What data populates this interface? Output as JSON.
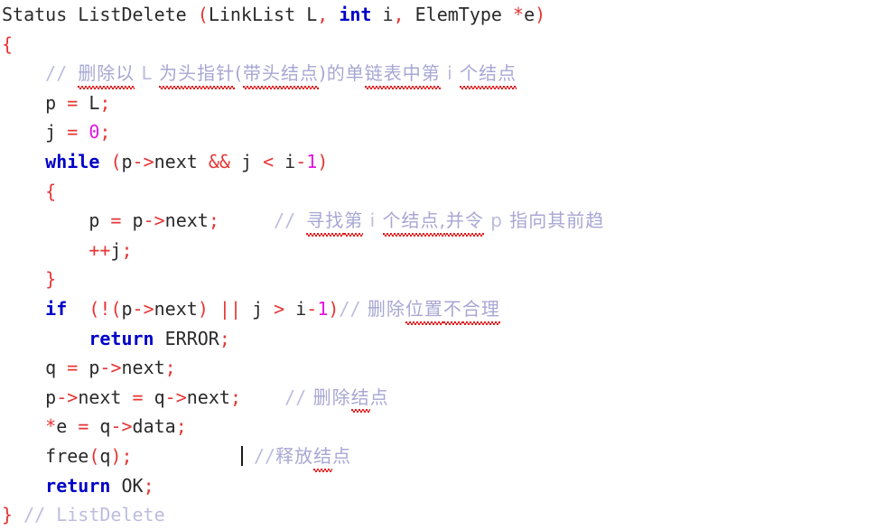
{
  "editor": {
    "language": "C",
    "background_color": "#ffffff",
    "font_size_px": 20,
    "caret_visible": true,
    "colors": {
      "plain_text": "#2a2a2a",
      "keyword": "#0000c8",
      "punctuation_operator": "#e63434",
      "number_literal": "#e215e2",
      "comment": "#bcbcdf",
      "spellcheck_underline": "#e01b1b"
    }
  },
  "code": {
    "function_name": "ListDelete",
    "lines": [
      {
        "n": 1,
        "indent": "",
        "text": "Status ListDelete (LinkList L, int i, ElemType *e)",
        "tokens": {
          "ret_type": "Status",
          "name": "ListDelete",
          "open_paren": "(",
          "param1_type": "LinkList",
          "param1_name": "L",
          "comma1": ",",
          "param2_type": "int",
          "param2_name": "i",
          "comma2": ",",
          "param3_type": "ElemType",
          "param3_star": "*",
          "param3_name": "e",
          "close_paren": ")"
        }
      },
      {
        "n": 2,
        "text": "{",
        "brace": "{"
      },
      {
        "n": 3,
        "comment_slashes": "//",
        "comment_parts": [
          {
            "t": "删除以",
            "spell": true
          },
          {
            "t": " L "
          },
          {
            "t": "为头指针",
            "spell": true
          },
          {
            "t": "("
          },
          {
            "t": "带头结点",
            "spell": true
          },
          {
            "t": ")的单"
          },
          {
            "t": "链表中第",
            "spell": true
          },
          {
            "t": " i "
          },
          {
            "t": "个结点",
            "spell": true
          }
        ],
        "comment_plain": "// 删除以 L 为头指针(带头结点)的单链表中第 i 个结点"
      },
      {
        "n": 4,
        "lhs": "p",
        "eq": "=",
        "rhs": "L",
        "semi": ";",
        "text": "p = L;"
      },
      {
        "n": 5,
        "lhs": "j",
        "eq": "=",
        "rhs": "0",
        "semi": ";",
        "text": "j = 0;"
      },
      {
        "n": 6,
        "keyword": "while",
        "text": "while (p->next && j < i-1)",
        "cond": "(p->next && j < i-1)"
      },
      {
        "n": 7,
        "brace": "{",
        "text": "{"
      },
      {
        "n": 8,
        "text": "p = p->next;",
        "comment_slashes": "//",
        "comment_parts": [
          {
            "t": "寻找",
            "spell": true
          },
          {
            "t": "第",
            "spell": true
          },
          {
            "t": " i "
          },
          {
            "t": "个结点",
            "spell": true
          },
          {
            "t": ",",
            "spell": true
          },
          {
            "t": "并令",
            "spell": true
          },
          {
            "t": " p "
          },
          {
            "t": "指向其前趋"
          }
        ],
        "comment_plain": "// 寻找第 i 个结点,并令 p 指向其前趋"
      },
      {
        "n": 9,
        "text": "++j;"
      },
      {
        "n": 10,
        "brace": "}",
        "text": "}"
      },
      {
        "n": 11,
        "keyword": "if",
        "text": "if  (!(p->next) || j > i-1)",
        "comment_slashes": "//",
        "comment_parts": [
          {
            "t": " 删除"
          },
          {
            "t": "位置",
            "spell": true
          },
          {
            "t": "不",
            "spell": true
          },
          {
            "t": "合理",
            "spell": true
          }
        ],
        "comment_plain": "// 删除位置不合理"
      },
      {
        "n": 12,
        "keyword": "return",
        "value": "ERROR",
        "semi": ";",
        "text": "return ERROR;"
      },
      {
        "n": 13,
        "text": "q = p->next;"
      },
      {
        "n": 14,
        "text": "p->next = q->next;",
        "comment_slashes": "//",
        "comment_parts": [
          {
            "t": " 删除"
          },
          {
            "t": "结",
            "spell": true
          },
          {
            "t": "点"
          }
        ],
        "comment_plain": "// 删除结点"
      },
      {
        "n": 15,
        "text": "*e = q->data;"
      },
      {
        "n": 16,
        "text": "free(q);",
        "has_caret": true,
        "comment_slashes": "//",
        "comment_parts": [
          {
            "t": "释放"
          },
          {
            "t": "结",
            "spell": true
          },
          {
            "t": "点"
          }
        ],
        "comment_plain": "//释放结点"
      },
      {
        "n": 17,
        "keyword": "return",
        "value": "OK",
        "semi": ";",
        "text": "return OK;"
      },
      {
        "n": 18,
        "brace": "}",
        "comment_plain": "// ListDelete",
        "text": "} // ListDelete"
      }
    ]
  }
}
